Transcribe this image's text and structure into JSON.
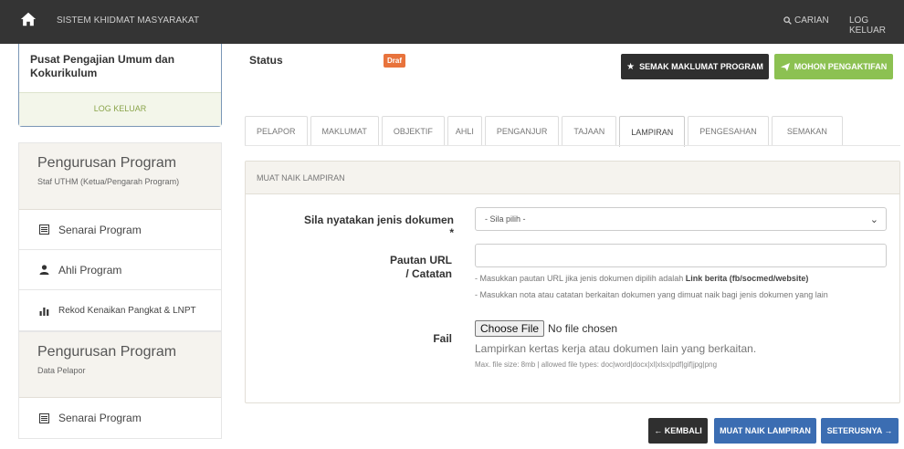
{
  "topbar": {
    "title": "SISTEM KHIDMAT MASYARAKAT",
    "search_label": "CARIAN",
    "logout_label": "LOG KELUAR",
    "icons": {
      "home": "home-icon",
      "search": "search-icon"
    }
  },
  "profile": {
    "name": "Pusat Pengajian Umum dan Kokurikulum",
    "logout_label": "LOG KELUAR"
  },
  "sidebar": {
    "sections": [
      {
        "title": "Pengurusan Program",
        "subtitle": "Staf UTHM (Ketua/Pengarah Program)",
        "items": [
          {
            "label": "Senarai Program",
            "icon": "list-icon"
          },
          {
            "label": "Ahli Program",
            "icon": "user-icon"
          },
          {
            "label": "Rekod Kenaikan Pangkat & LNPT",
            "icon": "bar-chart-icon"
          }
        ]
      },
      {
        "title": "Pengurusan Program",
        "subtitle": "Data Pelapor",
        "items": [
          {
            "label": "Senarai Program",
            "icon": "list-icon"
          }
        ]
      }
    ]
  },
  "main": {
    "status_label": "Status",
    "status_value": "Draf",
    "review_button": "SEMAK MAKLUMAT PROGRAM",
    "apply_button": "MOHON PENGAKTIFAN",
    "tabs": [
      {
        "label": "PELAPOR"
      },
      {
        "label": "MAKLUMAT"
      },
      {
        "label": "OBJEKTIF"
      },
      {
        "label": "AHLI"
      },
      {
        "label": "PENGANJUR"
      },
      {
        "label": "TAJAAN"
      },
      {
        "label": "LAMPIRAN"
      },
      {
        "label": "PENGESAHAN"
      },
      {
        "label": "SEMAKAN"
      }
    ],
    "active_tab": "LAMPIRAN"
  },
  "upload": {
    "panel_title": "MUAT NAIK LAMPIRAN",
    "doc_type_label": "Sila nyatakan jenis dokumen *",
    "doc_type_value": "- Sila pilih -",
    "url_label_line1": "Pautan URL",
    "url_label_line2": "/ Catatan",
    "url_value": "",
    "hint1_prefix": "- Masukkan pautan URL jika jenis dokumen dipilih adalah ",
    "hint1_bold": "Link berita (fb/socmed/website)",
    "hint2": "- Masukkan nota atau catatan berkaitan dokumen yang dimuat naik bagi jenis dokumen yang lain",
    "file_label": "Fail",
    "file_button": "Choose File",
    "file_status": "No file chosen",
    "file_help": "Lampirkan kertas kerja atau dokumen lain yang berkaitan.",
    "file_meta": "Max. file size: 8mb | allowed file types: doc|word|docx|xl|xlsx|pdf|gif|jpg|png"
  },
  "footer": {
    "back_button": "← KEMBALI",
    "upload_button": "MUAT NAIK LAMPIRAN",
    "next_button": "SETERUSNYA →"
  },
  "colors": {
    "topbar": "#343434",
    "draft_badge": "#e8733c",
    "apply_green": "#8cc152",
    "primary_blue": "#3b6db2",
    "dark_button": "#2f2f2f"
  }
}
